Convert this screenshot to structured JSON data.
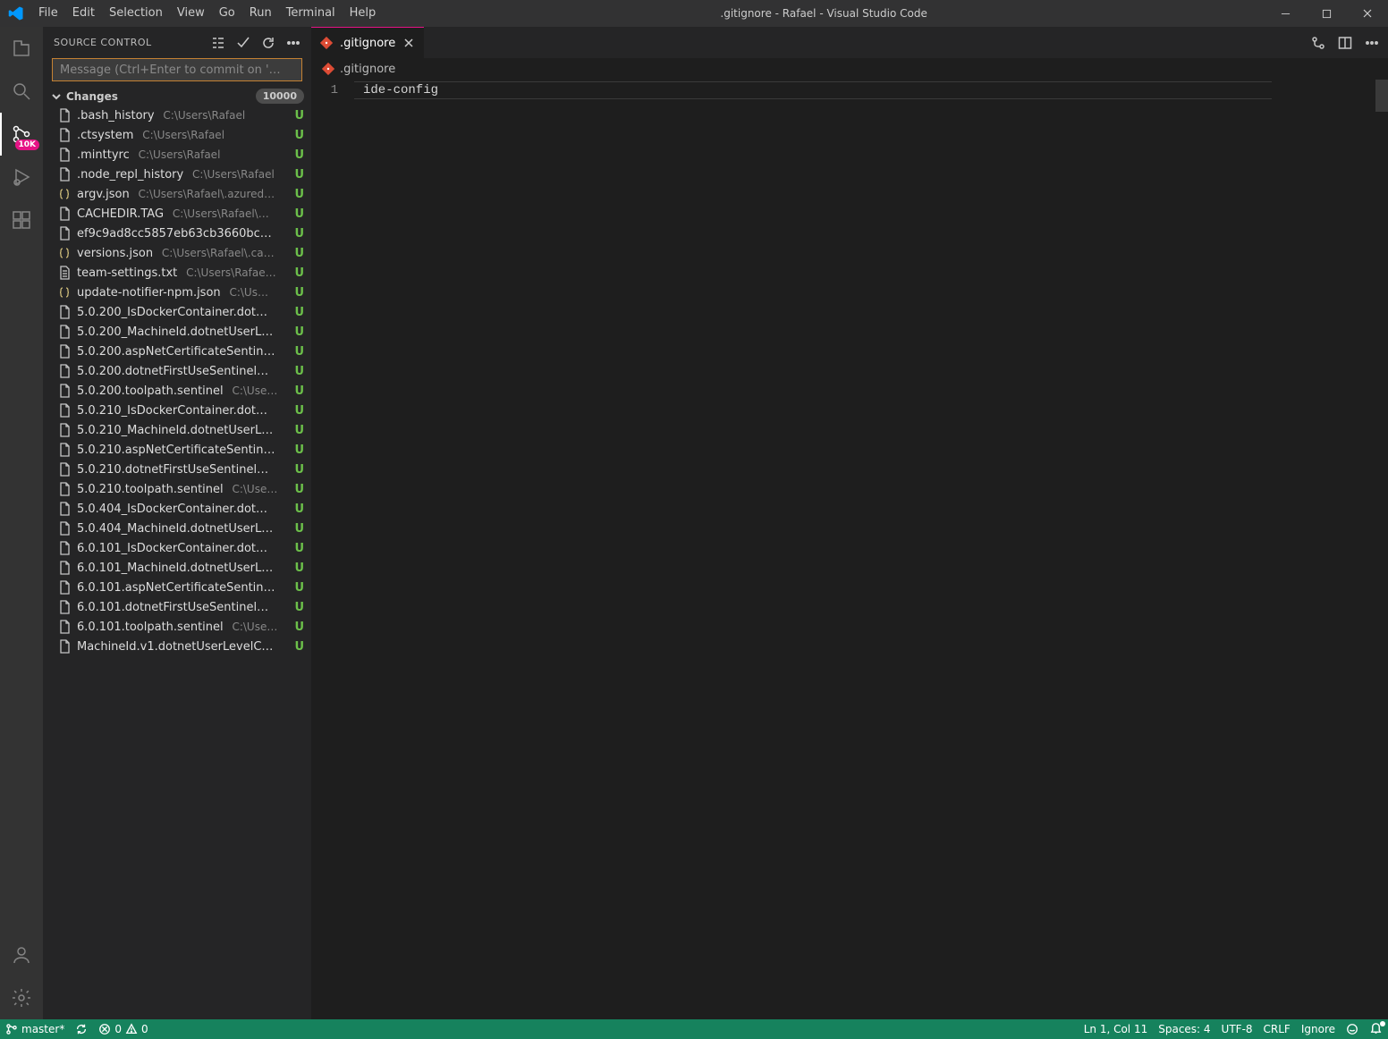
{
  "titlebar": {
    "menus": [
      "File",
      "Edit",
      "Selection",
      "View",
      "Go",
      "Run",
      "Terminal",
      "Help"
    ],
    "title": ".gitignore - Rafael - Visual Studio Code"
  },
  "activitybar": {
    "scm_badge": "10K"
  },
  "sidebar": {
    "title": "SOURCE CONTROL",
    "commit_placeholder": "Message (Ctrl+Enter to commit on '…",
    "changes_label": "Changes",
    "changes_count": "10000",
    "files": [
      {
        "icon": "file",
        "name": ".bash_history",
        "path": "C:\\Users\\Rafael",
        "letter": "U"
      },
      {
        "icon": "file",
        "name": ".ctsystem",
        "path": "C:\\Users\\Rafael",
        "letter": "U"
      },
      {
        "icon": "file",
        "name": ".minttyrc",
        "path": "C:\\Users\\Rafael",
        "letter": "U"
      },
      {
        "icon": "file",
        "name": ".node_repl_history",
        "path": "C:\\Users\\Rafael",
        "letter": "U"
      },
      {
        "icon": "json",
        "name": "argv.json",
        "path": "C:\\Users\\Rafael\\.azured…",
        "letter": "U"
      },
      {
        "icon": "file",
        "name": "CACHEDIR.TAG",
        "path": "C:\\Users\\Rafael\\…",
        "letter": "U"
      },
      {
        "icon": "file",
        "name": "ef9c9ad8cc5857eb63cb3660bc…",
        "path": "",
        "letter": "U"
      },
      {
        "icon": "json",
        "name": "versions.json",
        "path": "C:\\Users\\Rafael\\.ca…",
        "letter": "U"
      },
      {
        "icon": "txt",
        "name": "team-settings.txt",
        "path": "C:\\Users\\Rafae…",
        "letter": "U"
      },
      {
        "icon": "json",
        "name": "update-notifier-npm.json",
        "path": "C:\\Us…",
        "letter": "U"
      },
      {
        "icon": "file",
        "name": "5.0.200_IsDockerContainer.dot…",
        "path": "",
        "letter": "U"
      },
      {
        "icon": "file",
        "name": "5.0.200_MachineId.dotnetUserL…",
        "path": "",
        "letter": "U"
      },
      {
        "icon": "file",
        "name": "5.0.200.aspNetCertificateSentin…",
        "path": "",
        "letter": "U"
      },
      {
        "icon": "file",
        "name": "5.0.200.dotnetFirstUseSentinel…",
        "path": "",
        "letter": "U"
      },
      {
        "icon": "file",
        "name": "5.0.200.toolpath.sentinel",
        "path": "C:\\Use…",
        "letter": "U"
      },
      {
        "icon": "file",
        "name": "5.0.210_IsDockerContainer.dot…",
        "path": "",
        "letter": "U"
      },
      {
        "icon": "file",
        "name": "5.0.210_MachineId.dotnetUserL…",
        "path": "",
        "letter": "U"
      },
      {
        "icon": "file",
        "name": "5.0.210.aspNetCertificateSentin…",
        "path": "",
        "letter": "U"
      },
      {
        "icon": "file",
        "name": "5.0.210.dotnetFirstUseSentinel…",
        "path": "",
        "letter": "U"
      },
      {
        "icon": "file",
        "name": "5.0.210.toolpath.sentinel",
        "path": "C:\\Use…",
        "letter": "U"
      },
      {
        "icon": "file",
        "name": "5.0.404_IsDockerContainer.dot…",
        "path": "",
        "letter": "U"
      },
      {
        "icon": "file",
        "name": "5.0.404_MachineId.dotnetUserL…",
        "path": "",
        "letter": "U"
      },
      {
        "icon": "file",
        "name": "6.0.101_IsDockerContainer.dot…",
        "path": "",
        "letter": "U"
      },
      {
        "icon": "file",
        "name": "6.0.101_MachineId.dotnetUserL…",
        "path": "",
        "letter": "U"
      },
      {
        "icon": "file",
        "name": "6.0.101.aspNetCertificateSentin…",
        "path": "",
        "letter": "U"
      },
      {
        "icon": "file",
        "name": "6.0.101.dotnetFirstUseSentinel…",
        "path": "",
        "letter": "U"
      },
      {
        "icon": "file",
        "name": "6.0.101.toolpath.sentinel",
        "path": "C:\\Use…",
        "letter": "U"
      },
      {
        "icon": "file",
        "name": "MachineId.v1.dotnetUserLevelC…",
        "path": "",
        "letter": "U"
      }
    ]
  },
  "editor": {
    "tab_label": ".gitignore",
    "breadcrumb": ".gitignore",
    "line_number": "1",
    "code": "ide-config"
  },
  "status": {
    "branch": "master*",
    "errors": "0",
    "warnings": "0",
    "ln_col": "Ln 1, Col 11",
    "spaces": "Spaces: 4",
    "encoding": "UTF-8",
    "eol": "CRLF",
    "lang": "Ignore"
  }
}
